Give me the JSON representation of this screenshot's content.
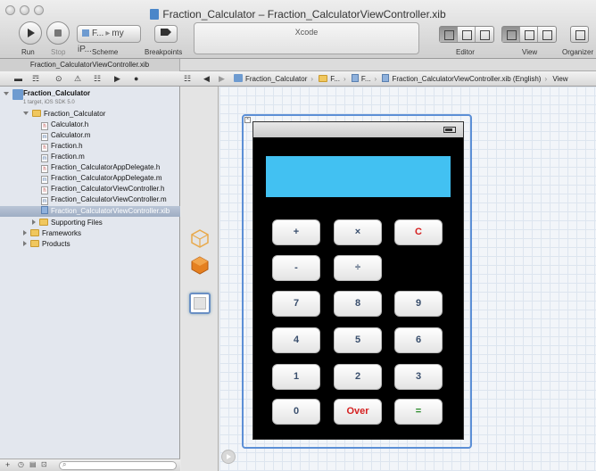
{
  "window": {
    "title": "Fraction_Calculator – Fraction_CalculatorViewController.xib"
  },
  "toolbar": {
    "run_label": "Run",
    "stop_label": "Stop",
    "scheme_label": "Scheme",
    "breakpoints_label": "Breakpoints",
    "scheme_value": "F...",
    "destination_value": "my iP...",
    "activity_text": "Xcode",
    "editor_label": "Editor",
    "view_label": "View",
    "organizer_label": "Organizer"
  },
  "tab": {
    "label": "Fraction_CalculatorViewController.xib"
  },
  "jumpbar": {
    "items": [
      "Fraction_Calculator",
      "F...",
      "F...",
      "Fraction_CalculatorViewController.xib (English)",
      "View"
    ]
  },
  "navigator": {
    "project": {
      "name": "Fraction_Calculator",
      "subtitle": "1 target, iOS SDK 5.0"
    },
    "group": "Fraction_Calculator",
    "files": [
      {
        "name": "Calculator.h",
        "type": "h"
      },
      {
        "name": "Calculator.m",
        "type": "m"
      },
      {
        "name": "Fraction.h",
        "type": "h"
      },
      {
        "name": "Fraction.m",
        "type": "m"
      },
      {
        "name": "Fraction_CalculatorAppDelegate.h",
        "type": "h"
      },
      {
        "name": "Fraction_CalculatorAppDelegate.m",
        "type": "m"
      },
      {
        "name": "Fraction_CalculatorViewController.h",
        "type": "h"
      },
      {
        "name": "Fraction_CalculatorViewController.m",
        "type": "m"
      },
      {
        "name": "Fraction_CalculatorViewController.xib",
        "type": "xib",
        "selected": true
      }
    ],
    "subgroups": [
      "Supporting Files",
      "Frameworks",
      "Products"
    ]
  },
  "calculator": {
    "buttons": {
      "plus": "+",
      "times": "×",
      "clear": "C",
      "minus": "-",
      "divide": "÷",
      "b7": "7",
      "b8": "8",
      "b9": "9",
      "b4": "4",
      "b5": "5",
      "b6": "6",
      "b1": "1",
      "b2": "2",
      "b3": "3",
      "b0": "0",
      "over": "Over",
      "equals": "="
    },
    "display_color": "#42c1f2"
  }
}
